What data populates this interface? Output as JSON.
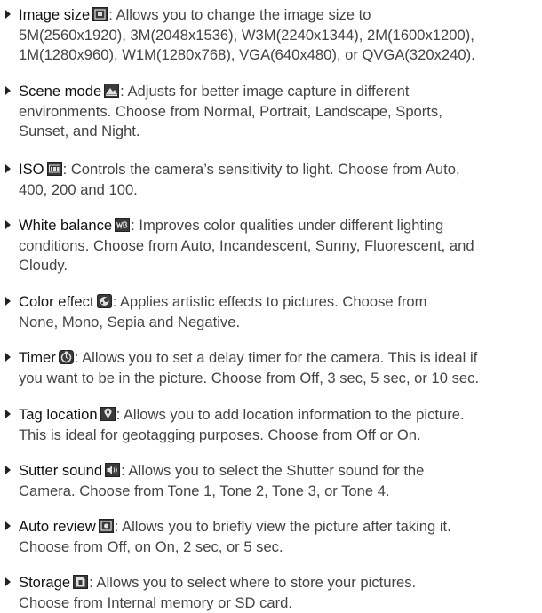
{
  "items": [
    {
      "term": "Image size",
      "icon": "image-size-icon",
      "description": ": Allows you to change the image size to\n5M(2560x1920), 3M(2048x1536), W3M(2240x1344), 2M(1600x1200),\n1M(1280x960), W1M(1280x768), VGA(640x480), or QVGA(320x240)."
    },
    {
      "term": "Scene mode",
      "icon": "scene-mode-icon",
      "description": ": Adjusts for better image capture in different\nenvironments. Choose from Normal, Portrait, Landscape, Sports,\nSunset, and Night."
    },
    {
      "term": "ISO",
      "icon": "iso-icon",
      "description": ": Controls the camera’s sensitivity to light. Choose from Auto,\n400, 200 and 100."
    },
    {
      "term": "White balance",
      "icon": "white-balance-icon",
      "description": ": Improves color qualities under different lighting\nconditions. Choose from Auto, Incandescent, Sunny, Fluorescent, and\nCloudy."
    },
    {
      "term": "Color effect",
      "icon": "color-effect-icon",
      "description": ": Applies artistic effects to pictures. Choose from\nNone, Mono, Sepia and Negative."
    },
    {
      "term": "Timer",
      "icon": "timer-icon",
      "description": ": Allows you to set a delay timer for the camera. This is ideal if\nyou want to be in the picture. Choose from Off, 3 sec, 5 sec, or 10 sec."
    },
    {
      "term": "Tag location",
      "icon": "tag-location-icon",
      "description": ": Allows you to add location information to the picture.\nThis is ideal for geotagging purposes. Choose from Off or On."
    },
    {
      "term": "Sutter sound",
      "icon": "shutter-sound-icon",
      "description": ": Allows you to select the Shutter sound for the\nCamera. Choose from Tone 1, Tone 2, Tone 3, or Tone 4."
    },
    {
      "term": "Auto review",
      "icon": "auto-review-icon",
      "description": ": Allows you to briefly view the picture after taking it.\nChoose from Off, on On, 2 sec, or  5 sec."
    },
    {
      "term": "Storage",
      "icon": "storage-icon",
      "description": ": Allows you to select where to store your pictures.\nChoose from Internal memory or SD card."
    }
  ]
}
